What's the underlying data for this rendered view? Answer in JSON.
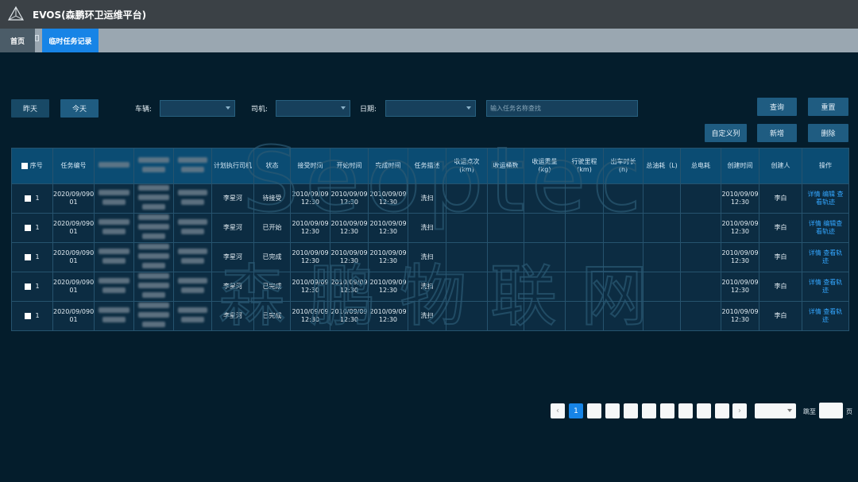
{
  "app": {
    "title": "EVOS(森鹏环卫运维平台)"
  },
  "tabs": {
    "home": "首页",
    "active": "临时任务记录"
  },
  "filters": {
    "yesterday": "昨天",
    "today": "今天",
    "vehicle_label": "车辆:",
    "driver_label": "司机:",
    "date_label": "日期:",
    "search_placeholder": "输入任务名称查找"
  },
  "actions": {
    "query": "查询",
    "reset": "重置",
    "custom_columns": "自定义列",
    "add": "新增",
    "delete": "删除"
  },
  "table": {
    "headers": {
      "seq": "序号",
      "task_no": "任务编号",
      "planned_driver": "计划执行司机",
      "status": "状态",
      "accept_time": "接受时间",
      "start_time": "开始时间",
      "finish_time": "完成时间",
      "task_desc": "任务描述",
      "trips": "收运点次\n(km)",
      "buckets": "收运桶数",
      "weight": "收运重量\n(kg)",
      "mileage": "行驶里程\n(km)",
      "duration": "出车时长\n(h)",
      "fuel": "总油耗（L)",
      "power": "总电耗",
      "created_time": "创建时间",
      "creator": "创建人",
      "ops": "操作"
    },
    "rows": [
      {
        "seq": "1",
        "task_no": "2020/09/090\n01",
        "driver": "李星河",
        "status": "待接受",
        "accept": "2010/09/09\n12:30",
        "start": "2010/09/09\n12:30",
        "finish": "2010/09/09\n12:30",
        "desc": "洗扫",
        "created": "2010/09/09\n12:30",
        "creator": "李白",
        "ops": "详情 编辑 查\n看轨迹"
      },
      {
        "seq": "1",
        "task_no": "2020/09/090\n01",
        "driver": "李星河",
        "status": "已开始",
        "accept": "2010/09/09\n12:30",
        "start": "2010/09/09\n12:30",
        "finish": "2010/09/09\n12:30",
        "desc": "洗扫",
        "created": "2010/09/09\n12:30",
        "creator": "李白",
        "ops": "详情 编辑查\n看轨迹"
      },
      {
        "seq": "1",
        "task_no": "2020/09/090\n01",
        "driver": "李星河",
        "status": "已完成",
        "accept": "2010/09/09\n12:30",
        "start": "2010/09/09\n12:30",
        "finish": "2010/09/09\n12:30",
        "desc": "洗扫",
        "created": "2010/09/09\n12:30",
        "creator": "李白",
        "ops": "详情 查看轨\n迹"
      },
      {
        "seq": "1",
        "task_no": "2020/09/090\n01",
        "driver": "李星河",
        "status": "已完成",
        "accept": "2010/09/09\n12:30",
        "start": "2010/09/09\n12:30",
        "finish": "2010/09/09\n12:30",
        "desc": "洗扫",
        "created": "2010/09/09\n12:30",
        "creator": "李白",
        "ops": "详情 查看轨\n迹"
      },
      {
        "seq": "1",
        "task_no": "2020/09/090\n01",
        "driver": "李星河",
        "status": "已完成",
        "accept": "2010/09/09\n12:30",
        "start": "2010/09/09\n12:30",
        "finish": "2010/09/09\n12:30",
        "desc": "洗扫",
        "created": "2010/09/09\n12:30",
        "creator": "李白",
        "ops": "详情 查看轨\n迹"
      }
    ]
  },
  "pagination": {
    "current": "1",
    "goto_label": "跳至",
    "goto_suffix": "页"
  },
  "watermark": {
    "line1": "Seoptec",
    "line2": "森鹏物联网"
  }
}
